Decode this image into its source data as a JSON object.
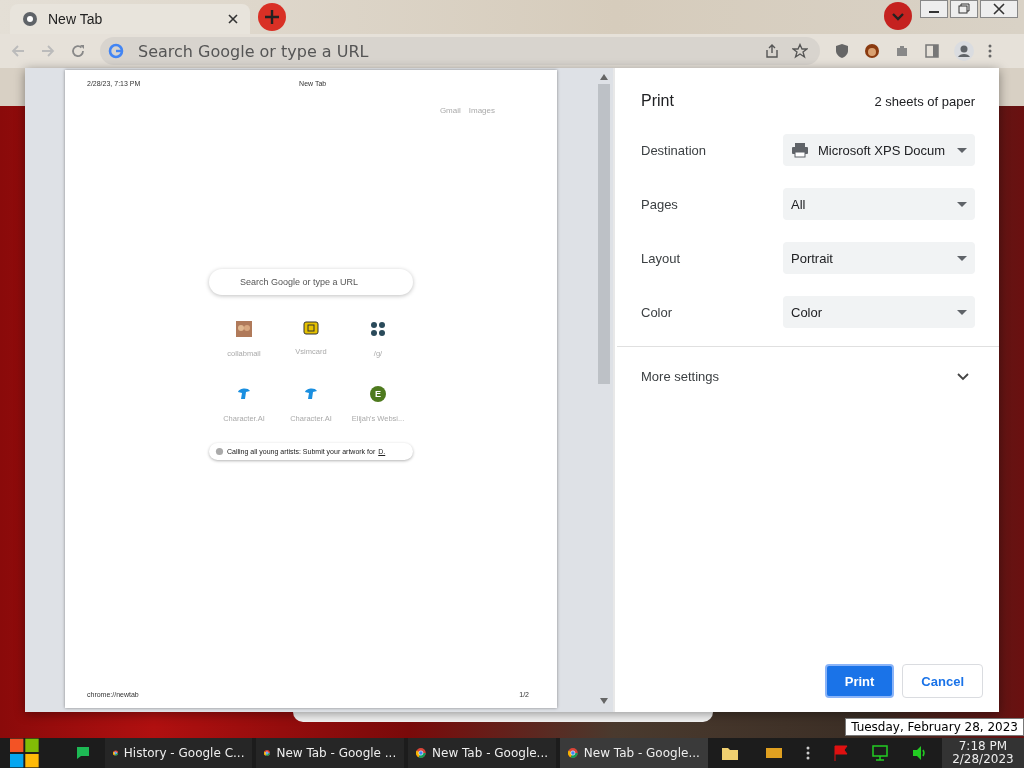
{
  "browser": {
    "tab": {
      "title": "New Tab"
    },
    "omnibox": {
      "placeholder": "Search Google or type a URL"
    }
  },
  "preview": {
    "header_date": "2/28/23, 7:13 PM",
    "header_title": "New Tab",
    "links": [
      "Gmail",
      "Images"
    ],
    "search": {
      "placeholder": "Search Google or type a URL"
    },
    "shortcuts": [
      {
        "label": "collabmail",
        "kind": "photo"
      },
      {
        "label": "Vsimcard",
        "kind": "card"
      },
      {
        "label": "/g/",
        "kind": "grid"
      },
      {
        "label": "Character.AI",
        "kind": "robot"
      },
      {
        "label": "Character.AI",
        "kind": "robot"
      },
      {
        "label": "Elijah's Websi...",
        "kind": "letter",
        "letter": "E",
        "color": "#4e7a1e"
      }
    ],
    "promo": {
      "text": "Calling all young artists: Submit your artwork for",
      "link": "D."
    },
    "footer_url": "chrome://newtab",
    "page_number": "1/2"
  },
  "print": {
    "title": "Print",
    "sheets": "2 sheets of paper",
    "settings": [
      {
        "label": "Destination",
        "value": "Microsoft XPS Docum",
        "kind": "printer"
      },
      {
        "label": "Pages",
        "value": "All",
        "kind": "select"
      },
      {
        "label": "Layout",
        "value": "Portrait",
        "kind": "select"
      },
      {
        "label": "Color",
        "value": "Color",
        "kind": "select"
      }
    ],
    "more_settings": {
      "label": "More settings",
      "expanded": false
    },
    "buttons": [
      {
        "label": "Print",
        "kind": "primary"
      },
      {
        "label": "Cancel",
        "kind": "secondary"
      }
    ]
  },
  "taskbar": {
    "items": [
      {
        "label": "History - Google C...",
        "selected": false
      },
      {
        "label": "New Tab - Google ...",
        "selected": false
      },
      {
        "label": "New Tab - Google...",
        "selected": false
      },
      {
        "label": "New Tab - Google...",
        "selected": true
      }
    ],
    "time": "7:18 PM",
    "date": "2/28/2023",
    "tooltip": "Tuesday, February 28, 2023"
  }
}
